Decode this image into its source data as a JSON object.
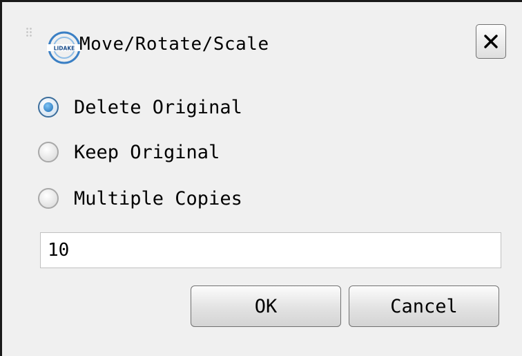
{
  "window": {
    "title": "Move/Rotate/Scale",
    "logo_text": "LIDAKE",
    "close_icon": "close-icon"
  },
  "options": [
    {
      "label": "Delete Original",
      "checked": true
    },
    {
      "label": "Keep Original",
      "checked": false
    },
    {
      "label": "Multiple Copies",
      "checked": false
    }
  ],
  "copies": {
    "value": "10"
  },
  "buttons": {
    "ok_label": "OK",
    "cancel_label": "Cancel"
  },
  "colors": {
    "radio_selected": "#1c6cb5",
    "logo_blue": "#3a7fc4"
  }
}
